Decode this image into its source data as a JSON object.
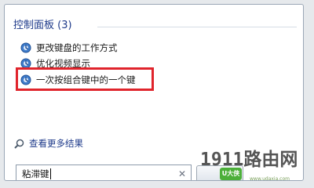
{
  "search_results": {
    "group_title": "控制面板 (3)",
    "items": [
      {
        "label": "更改键盘的工作方式",
        "icon": "control-panel-icon"
      },
      {
        "label": "优化视频显示",
        "icon": "control-panel-icon"
      },
      {
        "label": "一次按组合键中的一个键",
        "icon": "control-panel-icon",
        "highlighted": true
      }
    ],
    "see_more_label": "查看更多结果"
  },
  "search": {
    "value": "粘滞键",
    "clear_icon": "close-icon"
  },
  "watermark": {
    "text": "1911路由网",
    "badge": "U大侠",
    "url": "www.udaxia.com"
  },
  "colors": {
    "highlight_border": "#e0242c",
    "heading_text": "#1e3a8a",
    "panel_background": "#ffffff"
  }
}
